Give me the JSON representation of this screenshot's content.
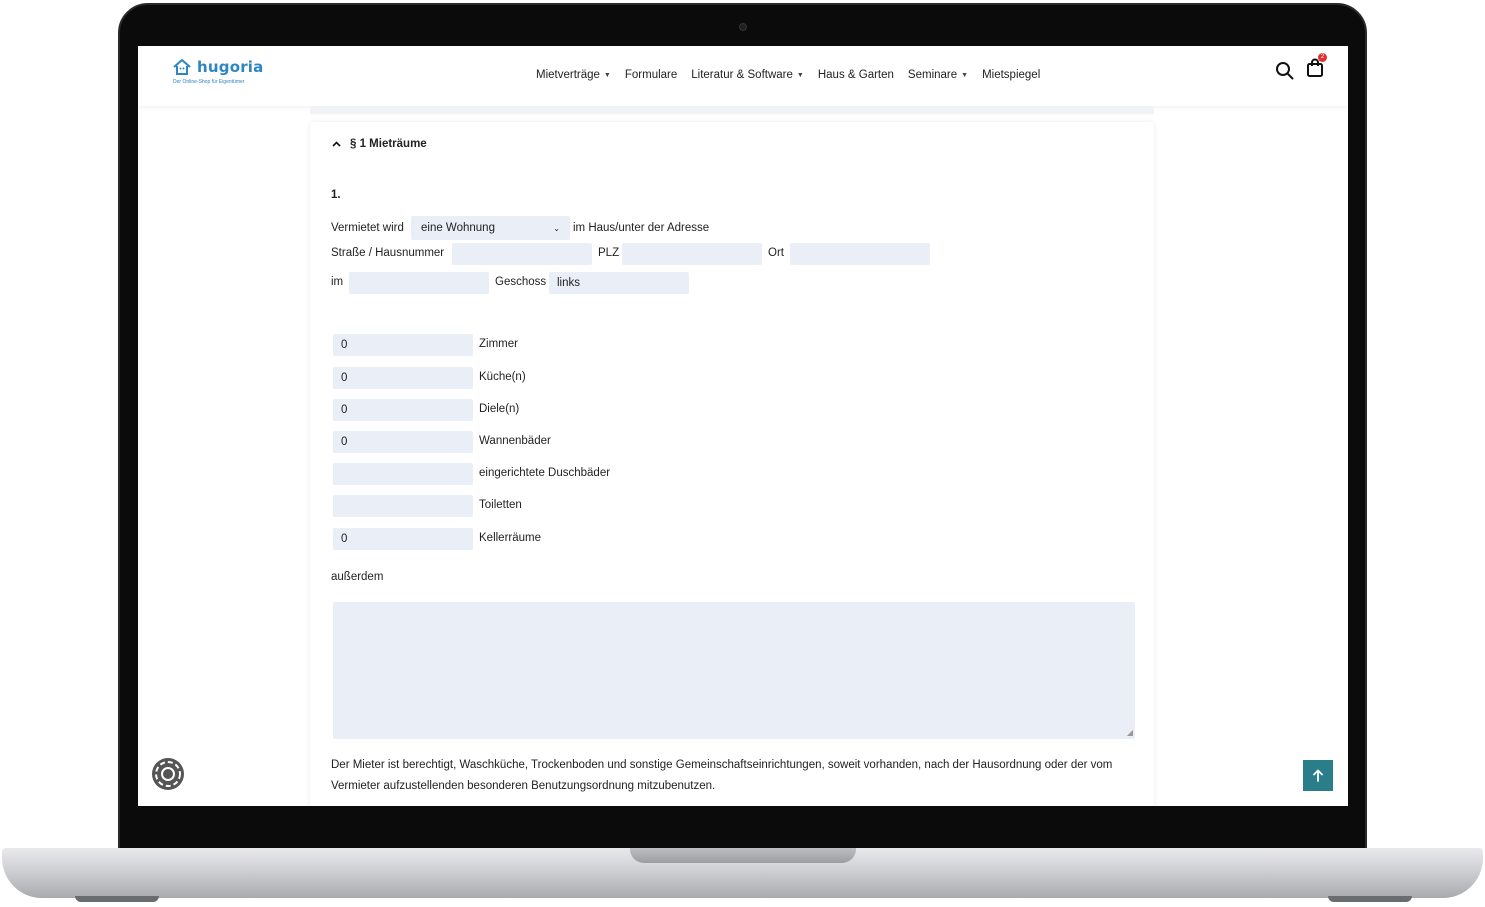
{
  "header": {
    "logo_name": "hugoria",
    "logo_tagline": "Der Online-Shop für Eigentümer",
    "nav": [
      {
        "label": "Mietverträge",
        "dropdown": true
      },
      {
        "label": "Formulare",
        "dropdown": false
      },
      {
        "label": "Literatur & Software",
        "dropdown": true
      },
      {
        "label": "Haus & Garten",
        "dropdown": false
      },
      {
        "label": "Seminare",
        "dropdown": true
      },
      {
        "label": "Mietspiegel",
        "dropdown": false
      }
    ],
    "cart_count": "2",
    "icons": [
      "search-icon",
      "shopping-bag-icon"
    ]
  },
  "section": {
    "title": "§ 1 Mieträume",
    "number": "1."
  },
  "form": {
    "rent_label": "Vermietet wird",
    "rent_select_value": "eine Wohnung",
    "rent_suffix": "im Haus/unter der Adresse",
    "street_label": "Straße / Hausnummer",
    "street_value": "",
    "plz_label": "PLZ",
    "plz_value": "",
    "ort_label": "Ort",
    "ort_value": "",
    "im_label": "im",
    "im_value": "",
    "geschoss_label": "Geschoss",
    "geschoss_value": "links",
    "rooms": [
      {
        "value": "0",
        "label": "Zimmer"
      },
      {
        "value": "0",
        "label": "Küche(n)"
      },
      {
        "value": "0",
        "label": "Diele(n)"
      },
      {
        "value": "0",
        "label": "Wannenbäder"
      },
      {
        "value": "",
        "label": "eingerichtete Duschbäder"
      },
      {
        "value": "",
        "label": "Toiletten"
      },
      {
        "value": "0",
        "label": "Kellerräume"
      }
    ],
    "ausserdem_label": "außerdem",
    "ausserdem_value": "",
    "note": "Der Mieter ist berechtigt, Waschküche, Trockenboden und sonstige Gemeinschaftseinrichtungen, soweit vorhanden, nach der Hausordnung oder der vom Vermieter aufzustellenden besonderen Benutzungsordnung mitzubenutzen."
  },
  "colors": {
    "accent": "#2a7e8a",
    "logo_blue": "#2e86c1",
    "input_bg": "#eaeef6",
    "badge_red": "#e03131"
  }
}
